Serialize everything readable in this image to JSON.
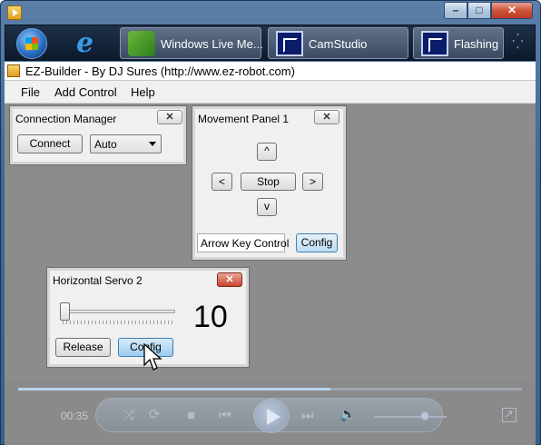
{
  "taskbar": {
    "tasks": [
      {
        "label": "Windows Live Me...",
        "icon": "messenger-icon"
      },
      {
        "label": "CamStudio",
        "icon": "camstudio-icon"
      },
      {
        "label": "Flashing",
        "icon": "camstudio-icon"
      }
    ]
  },
  "app": {
    "title": "EZ-Builder - By DJ Sures (http://www.ez-robot.com)"
  },
  "menu": [
    "File",
    "Add Control",
    "Help"
  ],
  "connection_manager": {
    "title": "Connection Manager",
    "connect_label": "Connect",
    "port_value": "Auto"
  },
  "movement_panel": {
    "title": "Movement Panel 1",
    "up_label": "^",
    "left_label": "<",
    "stop_label": "Stop",
    "right_label": ">",
    "down_label": "v",
    "control_value": "Arrow Key Control",
    "config_label": "Config"
  },
  "servo": {
    "title": "Horizontal Servo 2",
    "value": "10",
    "slider_fraction": 0.0,
    "release_label": "Release",
    "config_label": "Config"
  },
  "player": {
    "time": "00:35",
    "seek_fraction": 0.62
  },
  "colors": {
    "workspace": "#8c8c8c",
    "title_gradient": "#3f6896",
    "close_red": "#c9452c",
    "config_blue": "#bfdcf2"
  }
}
